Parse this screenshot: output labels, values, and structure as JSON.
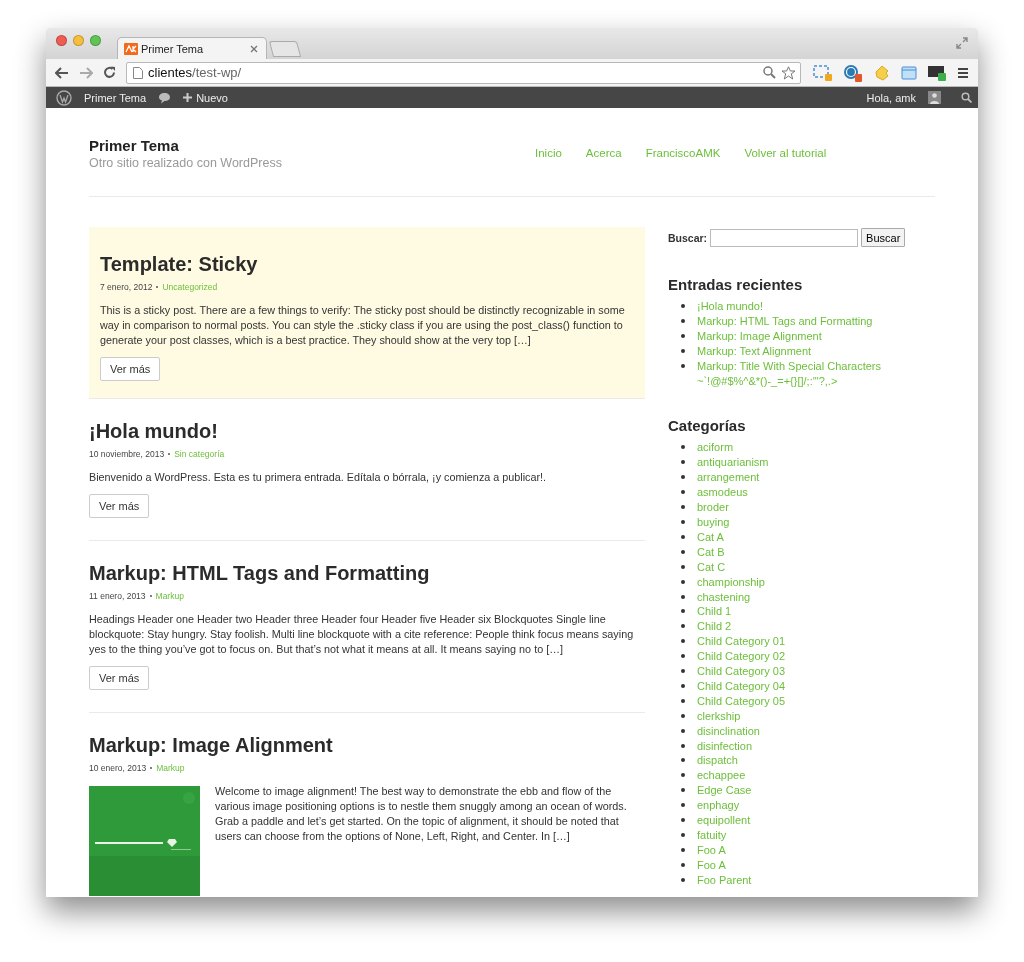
{
  "browser": {
    "tab_title": "Primer Tema",
    "url_host": "clientes",
    "url_path": "/test-wp/"
  },
  "admin_bar": {
    "site": "Primer Tema",
    "new": "Nuevo",
    "greeting": "Hola, amk"
  },
  "site": {
    "title": "Primer Tema",
    "tagline": "Otro sitio realizado con WordPress",
    "nav": [
      "Inicio",
      "Acerca",
      "FranciscoAMK",
      "Volver al tutorial"
    ]
  },
  "posts": [
    {
      "kind": "text",
      "sticky": true,
      "title": "Template: Sticky",
      "date": "7 enero, 2012",
      "category": "Uncategorized",
      "excerpt": "This is a sticky post. There are a few things to verify: The sticky post should be distinctly recognizable in some way in comparison to normal posts. You can style the .sticky class if you are using the post_class() function to generate your post classes, which is a best practice. They should show at the very top […]",
      "more": "Ver más"
    },
    {
      "kind": "text",
      "sticky": false,
      "title": "¡Hola mundo!",
      "date": "10 noviembre, 2013",
      "category": "Sin categoría",
      "excerpt": "Bienvenido a WordPress. Esta es tu primera entrada. Edítala o bórrala, ¡y comienza a publicar!.",
      "more": "Ver más"
    },
    {
      "kind": "text",
      "sticky": false,
      "title": "Markup: HTML Tags and Formatting",
      "date": "11 enero, 2013",
      "category": "Markup",
      "excerpt": "Headings Header one Header two Header three Header four Header five Header six Blockquotes Single line blockquote: Stay hungry. Stay foolish. Multi line blockquote with a cite reference: People think focus means saying yes to the thing you’ve got to focus on. But that’s not what it means at all. It means saying no to […]",
      "more": "Ver más"
    },
    {
      "sticky": false,
      "title": "Markup: Image Alignment",
      "date": "10 enero, 2013",
      "category": "Markup",
      "excerpt": "Welcome to image alignment! The best way to demonstrate the ebb and flow of the various image positioning options is to nestle them snuggly among an ocean of words. Grab a paddle and let’s get started. On the topic of alignment, it should be noted that users can choose from the options of None, Left, Right, and Center. In […]"
    }
  ],
  "sidebar": {
    "search_label": "Buscar:",
    "search_button": "Buscar",
    "recent_title": "Entradas recientes",
    "recent": [
      "¡Hola mundo!",
      "Markup: HTML Tags and Formatting",
      "Markup: Image Alignment",
      "Markup: Text Alignment",
      "Markup: Title With Special Characters ~`!@#$%^&*()-_=+{}[]/;:'\"?,.>"
    ],
    "categories_title": "Categorías",
    "categories": [
      "aciform",
      "antiquarianism",
      "arrangement",
      "asmodeus",
      "broder",
      "buying",
      "Cat A",
      "Cat B",
      "Cat C",
      "championship",
      "chastening",
      "Child 1",
      "Child 2",
      "Child Category 01",
      "Child Category 02",
      "Child Category 03",
      "Child Category 04",
      "Child Category 05",
      "clerkship",
      "disinclination",
      "disinfection",
      "dispatch",
      "echappee",
      "Edge Case",
      "enphagy",
      "equipollent",
      "fatuity",
      "Foo A",
      "Foo A",
      "Foo Parent"
    ]
  }
}
